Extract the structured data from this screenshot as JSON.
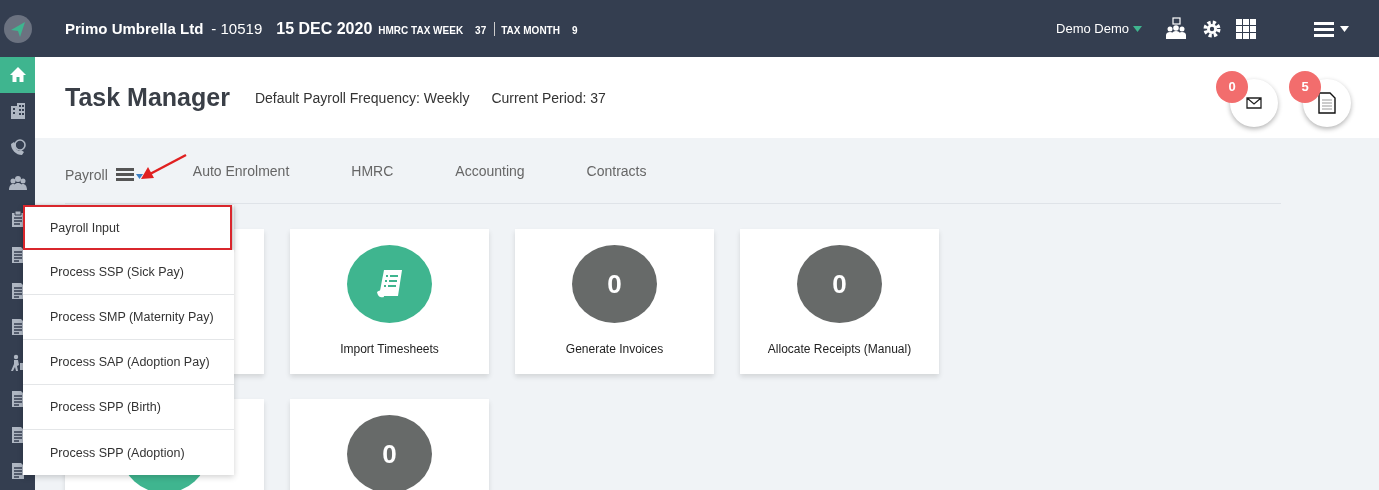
{
  "topbar": {
    "company": "Primo Umbrella Ltd",
    "company_no": "- 10519",
    "date": "15 DEC 2020",
    "tax_week_label": "HMRC TAX WEEK",
    "tax_week": "37",
    "tax_month_label": "TAX MONTH",
    "tax_month": "9",
    "user": "Demo Demo"
  },
  "sidebar": {
    "items": [
      {
        "kind": "home",
        "selected": true
      },
      {
        "kind": "building",
        "selected": false
      },
      {
        "kind": "phone",
        "selected": false
      },
      {
        "kind": "people",
        "selected": false
      },
      {
        "kind": "clipboard",
        "selected": false
      },
      {
        "kind": "document",
        "selected": false
      },
      {
        "kind": "document",
        "selected": false
      },
      {
        "kind": "document",
        "selected": false
      },
      {
        "kind": "person",
        "selected": false
      },
      {
        "kind": "document",
        "selected": false
      },
      {
        "kind": "document",
        "selected": false
      },
      {
        "kind": "document",
        "selected": false
      }
    ]
  },
  "header": {
    "title": "Task Manager",
    "frequency": "Default Payroll Frequency: Weekly",
    "period": "Current Period: 37",
    "badges": [
      {
        "kind": "mail",
        "count": "0"
      },
      {
        "kind": "document",
        "count": "5"
      }
    ]
  },
  "tabs": [
    {
      "label": "Payroll",
      "kind": "menu"
    },
    {
      "label": "Auto Enrolment",
      "kind": "plain"
    },
    {
      "label": "HMRC",
      "kind": "plain"
    },
    {
      "label": "Accounting",
      "kind": "plain"
    },
    {
      "label": "Contracts",
      "kind": "plain"
    }
  ],
  "dropdown": {
    "items": [
      {
        "label": "Payroll Input",
        "highlighted": true
      },
      {
        "label": "Process SSP (Sick Pay)",
        "highlighted": false
      },
      {
        "label": "Process SMP (Maternity Pay)",
        "highlighted": false
      },
      {
        "label": "Process SAP (Adoption Pay)",
        "highlighted": false
      },
      {
        "label": "Process SPP (Birth)",
        "highlighted": false
      },
      {
        "label": "Process SPP (Adoption)",
        "highlighted": false
      }
    ]
  },
  "tiles": [
    {
      "kind": "blank"
    },
    {
      "kind": "icon",
      "label": "Import Timesheets"
    },
    {
      "kind": "count",
      "count": "0",
      "label": "Generate Invoices"
    },
    {
      "kind": "count",
      "count": "0",
      "label": "Allocate Receipts (Manual)"
    },
    {
      "kind": "circle"
    },
    {
      "kind": "count",
      "count": "0"
    }
  ]
}
